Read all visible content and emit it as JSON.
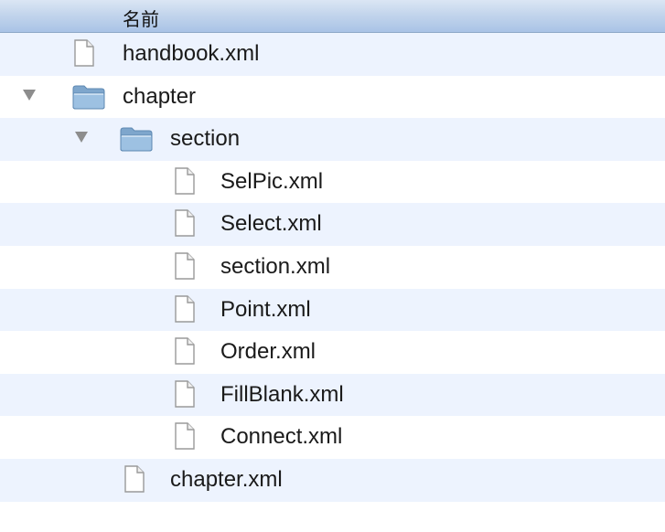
{
  "header": {
    "name_column": "名前"
  },
  "tree": [
    {
      "label": "handbook.xml",
      "type": "file",
      "depth": 1,
      "expanded": false
    },
    {
      "label": "chapter",
      "type": "folder",
      "depth": 0,
      "expanded": true
    },
    {
      "label": "section",
      "type": "folder",
      "depth": 1,
      "expanded": true
    },
    {
      "label": "SelPic.xml",
      "type": "file",
      "depth": 3,
      "expanded": false
    },
    {
      "label": "Select.xml",
      "type": "file",
      "depth": 3,
      "expanded": false
    },
    {
      "label": "section.xml",
      "type": "file",
      "depth": 3,
      "expanded": false
    },
    {
      "label": "Point.xml",
      "type": "file",
      "depth": 3,
      "expanded": false
    },
    {
      "label": "Order.xml",
      "type": "file",
      "depth": 3,
      "expanded": false
    },
    {
      "label": "FillBlank.xml",
      "type": "file",
      "depth": 3,
      "expanded": false
    },
    {
      "label": "Connect.xml",
      "type": "file",
      "depth": 3,
      "expanded": false
    },
    {
      "label": "chapter.xml",
      "type": "file",
      "depth": 2,
      "expanded": false
    }
  ],
  "icons": {
    "file": "document-icon",
    "folder": "folder-icon",
    "expanded": "disclosure-triangle-down-icon"
  },
  "colors": {
    "header_top": "#dbe6f4",
    "header_bottom": "#a9c3e6",
    "row_stripe": "#edf3fe",
    "folder_body": "#8fb5d8",
    "arrow": "#8d8d8d"
  }
}
